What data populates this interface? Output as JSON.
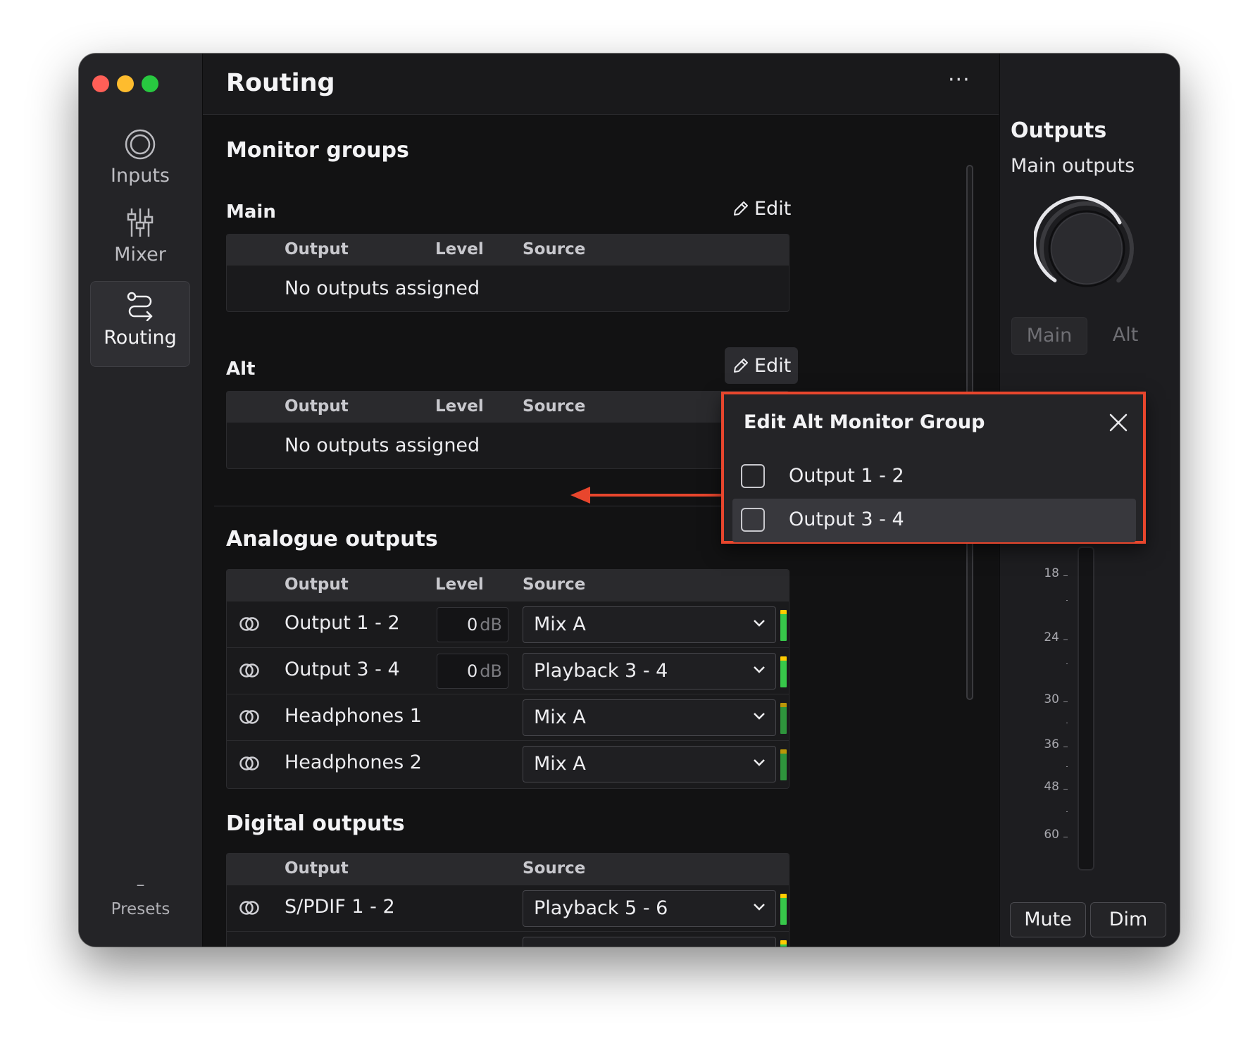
{
  "window": {
    "traffic_lights": {
      "close": "#ff5f57",
      "minimize": "#febc2e",
      "zoom": "#28c840"
    }
  },
  "sidebar": {
    "items": [
      {
        "label": "Inputs",
        "icon": "inputs-rings-icon"
      },
      {
        "label": "Mixer",
        "icon": "mixer-faders-icon"
      },
      {
        "label": "Routing",
        "icon": "routing-arrows-icon",
        "active": true
      }
    ],
    "presets": {
      "symbol": "–",
      "label": "Presets"
    }
  },
  "header": {
    "title": "Routing",
    "more": "···"
  },
  "monitor_groups": {
    "title": "Monitor groups",
    "main": {
      "label": "Main",
      "edit": "Edit",
      "empty": "No outputs assigned"
    },
    "alt": {
      "label": "Alt",
      "edit": "Edit",
      "empty": "No outputs assigned"
    },
    "columns": {
      "output": "Output",
      "level": "Level",
      "source": "Source"
    }
  },
  "analogue": {
    "title": "Analogue outputs",
    "columns": {
      "output": "Output",
      "level": "Level",
      "source": "Source"
    },
    "rows": [
      {
        "output": "Output 1 - 2",
        "level": "0",
        "unit": "dB",
        "source": "Mix A"
      },
      {
        "output": "Output 3 - 4",
        "level": "0",
        "unit": "dB",
        "source": "Playback 3 - 4"
      },
      {
        "output": "Headphones 1",
        "source": "Mix A"
      },
      {
        "output": "Headphones 2",
        "source": "Mix A"
      }
    ]
  },
  "digital": {
    "title": "Digital outputs",
    "columns": {
      "output": "Output",
      "source": "Source"
    },
    "rows": [
      {
        "output": "S/PDIF 1 - 2",
        "source": "Playback 5 - 6"
      }
    ]
  },
  "outputs_panel": {
    "title": "Outputs",
    "subtitle": "Main outputs",
    "seg_main": "Main",
    "seg_alt": "Alt",
    "ticks": [
      "18",
      "24",
      "30",
      "36",
      "48",
      "60"
    ],
    "mute": "Mute",
    "dim": "Dim"
  },
  "popup": {
    "title": "Edit Alt Monitor Group",
    "options": [
      {
        "label": "Output 1 - 2",
        "checked": false
      },
      {
        "label": "Output 3 - 4",
        "checked": false
      }
    ],
    "highlight_color": "#e8462d"
  },
  "colors": {
    "accent_red": "#e8462d",
    "meter_green": "#37c84a",
    "meter_yellow": "#ffcc00"
  }
}
